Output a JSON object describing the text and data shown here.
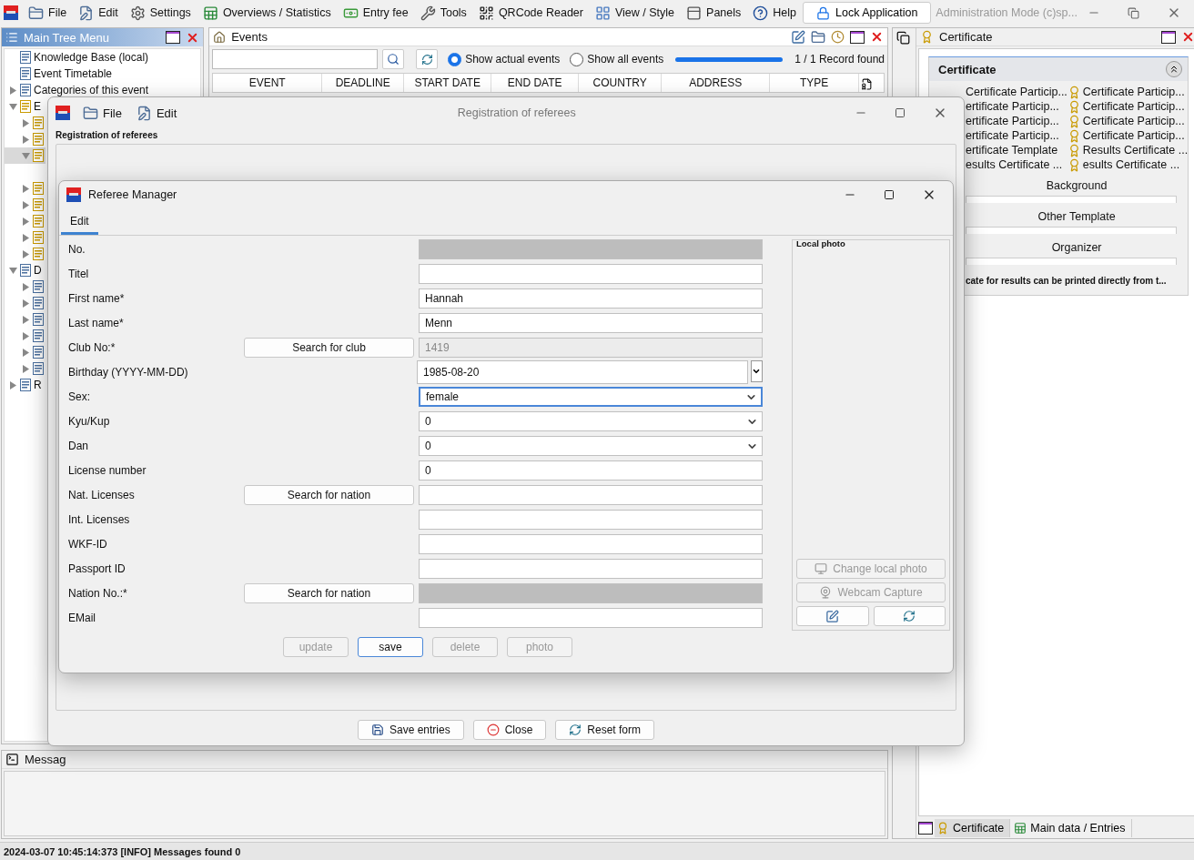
{
  "menu_bar": {
    "items": [
      "File",
      "Edit",
      "Settings",
      "Overviews / Statistics",
      "Entry fee",
      "Tools",
      "QRCode Reader",
      "View / Style",
      "Panels",
      "Help"
    ],
    "lock_button": "Lock Application",
    "mode": "Administration Mode (c)sp..."
  },
  "tree_panel": {
    "title": "Main Tree Menu",
    "items": [
      {
        "label": "Knowledge Base (local)",
        "selected": false
      },
      {
        "label": "Event Timetable",
        "selected": false
      },
      {
        "label": "Categories of this event",
        "expanded": false,
        "selected": false
      },
      {
        "label": "E",
        "expanded": true,
        "selected": false,
        "children": [
          {
            "expanded": false,
            "selected": false
          },
          {
            "expanded": false,
            "selected": false
          },
          {
            "expanded": true,
            "selected": true
          },
          {
            "expanded": false,
            "selected": false
          },
          {
            "expanded": false,
            "selected": false
          },
          {
            "expanded": false,
            "selected": false
          },
          {
            "expanded": false,
            "selected": false
          },
          {
            "expanded": false,
            "selected": false
          }
        ]
      },
      {
        "label": "D",
        "expanded": true,
        "selected": false,
        "children": [
          {
            "expanded": false,
            "selected": false
          },
          {
            "expanded": false,
            "selected": false
          },
          {
            "expanded": false,
            "selected": false
          },
          {
            "expanded": false,
            "selected": false
          },
          {
            "expanded": false,
            "selected": false
          },
          {
            "expanded": false,
            "selected": false
          }
        ]
      },
      {
        "label": "R",
        "expanded": false,
        "selected": false
      }
    ]
  },
  "events_panel": {
    "title": "Events",
    "filters": [
      {
        "label": "Show actual events",
        "selected": true
      },
      {
        "label": "Show all events",
        "selected": false
      }
    ],
    "progress": {
      "level": 1
    },
    "record_count": "1 / 1 Record found",
    "columns": [
      "EVENT",
      "DEADLINE",
      "START DATE",
      "END DATE",
      "COUNTRY",
      "ADDRESS",
      "TYPE"
    ]
  },
  "messages_panel": {
    "title": "Messag"
  },
  "certificate_panel": {
    "title": "Certificate",
    "section": {
      "title": "Certificate",
      "expanded": true,
      "templates": [
        "Certificate Particip...",
        "Certificate Particip...",
        "ertificate Particip...",
        "Certificate Particip...",
        "ertificate Particip...",
        "Certificate Particip...",
        "ertificate Particip...",
        "Certificate Particip...",
        "ertificate Template",
        "Results Certificate ...",
        "esults Certificate ...",
        "esults Certificate ..."
      ],
      "fields": [
        {
          "label": "Background"
        },
        {
          "label": "Other Template"
        },
        {
          "label": "Organizer"
        }
      ],
      "note": "cate for results can be printed directly from t..."
    },
    "tabs": [
      {
        "label": "Certificate",
        "selected": true
      },
      {
        "label": "Main data / Entries",
        "selected": false
      }
    ]
  },
  "status_bar": "2024-03-07 10:45:14:373 [INFO] Messages found 0",
  "registration_window": {
    "title": "Registration of referees",
    "menu": [
      "File",
      "Edit"
    ],
    "group_title": "Registration of referees",
    "buttons": [
      "Save entries",
      "Close",
      "Reset form"
    ]
  },
  "referee_dialog": {
    "title": "Referee Manager",
    "tabs": [
      {
        "label": "Edit",
        "selected": true
      }
    ],
    "rows": [
      {
        "label": "No.",
        "field": {
          "kind": "text",
          "disabled": true,
          "focused": false
        }
      },
      {
        "label": "Titel",
        "field": {
          "kind": "text",
          "disabled": false,
          "focused": false
        }
      },
      {
        "label": "First name*",
        "field": {
          "kind": "text",
          "value": "Hannah",
          "disabled": false,
          "focused": false
        }
      },
      {
        "label": "Last name*",
        "field": {
          "kind": "text",
          "value": "Menn",
          "disabled": false,
          "focused": false
        }
      },
      {
        "label": "Club No:*",
        "button": "Search for club",
        "field": {
          "kind": "text",
          "value": "1419",
          "disabled": true,
          "focused": false
        }
      },
      {
        "label": "Birthday (YYYY-MM-DD)",
        "field": {
          "kind": "date",
          "value": "1985-08-20",
          "disabled": false,
          "focused": false
        }
      },
      {
        "label": "Sex:",
        "field": {
          "kind": "select",
          "value": "female",
          "disabled": false,
          "focused": true
        }
      },
      {
        "label": "Kyu/Kup",
        "field": {
          "kind": "select",
          "value": "0",
          "disabled": false,
          "focused": false
        }
      },
      {
        "label": "Dan",
        "field": {
          "kind": "select",
          "value": "0",
          "disabled": false,
          "focused": false
        }
      },
      {
        "label": "License number",
        "field": {
          "kind": "text",
          "value": "0",
          "disabled": false,
          "focused": false
        }
      },
      {
        "label": "Nat. Licenses",
        "button": "Search for nation",
        "field": {
          "kind": "text",
          "disabled": false,
          "focused": false
        }
      },
      {
        "label": "Int. Licenses",
        "field": {
          "kind": "text",
          "disabled": false,
          "focused": false
        }
      },
      {
        "label": "WKF-ID",
        "field": {
          "kind": "text",
          "disabled": false,
          "focused": false
        }
      },
      {
        "label": "Passport ID",
        "field": {
          "kind": "text",
          "disabled": false,
          "focused": false
        }
      },
      {
        "label": "Nation No.:*",
        "button": "Search for nation",
        "field": {
          "kind": "text",
          "disabled": true,
          "focused": false
        }
      },
      {
        "label": "EMail",
        "field": {
          "kind": "text",
          "disabled": false,
          "focused": false
        }
      }
    ],
    "photo": {
      "title": "Local photo",
      "buttons": [
        {
          "label": "Change local photo",
          "disabled": true
        },
        {
          "label": "Webcam Capture",
          "disabled": true
        }
      ]
    },
    "actions": [
      {
        "label": "update",
        "disabled": true,
        "focused": false
      },
      {
        "label": "save",
        "disabled": false,
        "focused": true
      },
      {
        "label": "delete",
        "disabled": true,
        "focused": false
      },
      {
        "label": "photo",
        "disabled": true,
        "focused": false
      }
    ]
  }
}
